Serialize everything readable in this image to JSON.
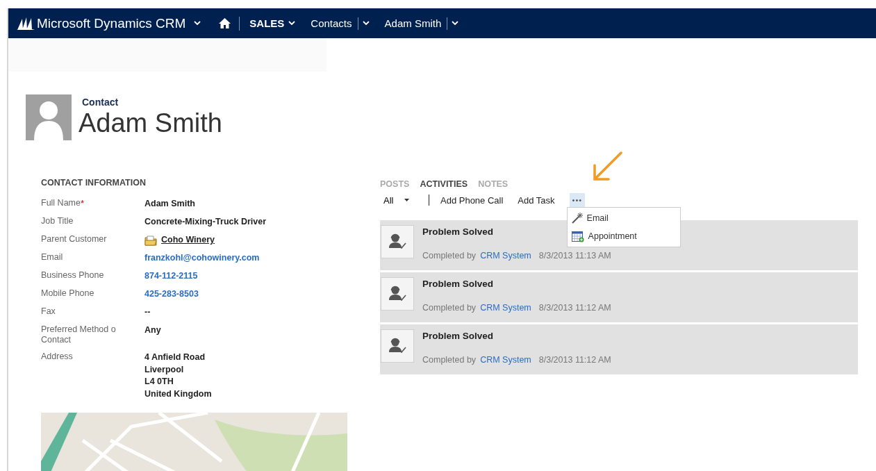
{
  "nav": {
    "app_title": "Microsoft Dynamics CRM",
    "items": [
      {
        "label": "SALES",
        "kind": "area"
      },
      {
        "label": "Contacts",
        "kind": "split"
      },
      {
        "label": "Adam Smith",
        "kind": "split"
      }
    ]
  },
  "record": {
    "entity": "Contact",
    "name": "Adam Smith"
  },
  "section": {
    "title": "CONTACT INFORMATION",
    "fields": [
      {
        "label": "Full Name",
        "required_mark": "*",
        "value": "Adam Smith",
        "kind": "text"
      },
      {
        "label": "Job Title",
        "value": "Concrete-Mixing-Truck Driver",
        "kind": "text"
      },
      {
        "label": "Parent Customer",
        "value": "Coho Winery",
        "kind": "lookup"
      },
      {
        "label": "Email",
        "value": "franzkohl@cohowinery.com",
        "kind": "link"
      },
      {
        "label": "Business Phone",
        "value": "874-112-2115",
        "kind": "link"
      },
      {
        "label": "Mobile Phone",
        "value": "425-283-8503",
        "kind": "link"
      },
      {
        "label": "Fax",
        "value": "--",
        "kind": "text"
      },
      {
        "label": "Preferred Method o Contact",
        "value": "Any",
        "kind": "text"
      },
      {
        "label": "Address",
        "lines": [
          "4 Anfield Road",
          "Liverpool",
          "L4 0TH",
          "United Kingdom"
        ],
        "kind": "address"
      }
    ]
  },
  "activity_panel": {
    "tabs": [
      {
        "label": "POSTS",
        "selected": false
      },
      {
        "label": "ACTIVITIES",
        "selected": true
      },
      {
        "label": "NOTES",
        "selected": false
      }
    ],
    "filter": "All",
    "actions": [
      "Add Phone Call",
      "Add Task"
    ],
    "more_button": {
      "label": "•••",
      "pointed": true
    },
    "more_menu": {
      "open": true,
      "items": [
        {
          "label": "Email",
          "kind": "email"
        },
        {
          "label": "Appointment",
          "kind": "appointment"
        }
      ]
    },
    "activities": [
      {
        "title": "Problem Solved",
        "by_label": "Completed by",
        "by": "CRM System",
        "time": "8/3/2013 11:13 AM"
      },
      {
        "title": "Problem Solved",
        "by_label": "Completed by",
        "by": "CRM System",
        "time": "8/3/2013 11:12 AM"
      },
      {
        "title": "Problem Solved",
        "by_label": "Completed by",
        "by": "CRM System",
        "time": "8/3/2013 11:12 AM"
      }
    ]
  }
}
